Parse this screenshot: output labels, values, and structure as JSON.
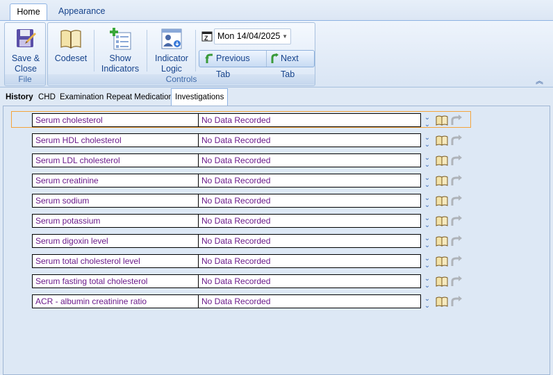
{
  "ribbon": {
    "tabs": [
      {
        "label": "Home",
        "active": true
      },
      {
        "label": "Appearance",
        "active": false
      }
    ],
    "groups": {
      "file": {
        "label": "File",
        "save_close_label_1": "Save &",
        "save_close_label_2": "Close"
      },
      "controls": {
        "label": "Controls",
        "codeset_label": "Codeset",
        "show_indicators_label_1": "Show",
        "show_indicators_label_2": "Indicators",
        "indicator_logic_label_1": "Indicator",
        "indicator_logic_label_2": "Logic",
        "date_value": "Mon 14/04/2025",
        "previous_tab_label": "Previous Tab",
        "next_tab_label": "Next Tab"
      }
    },
    "collapse_glyph": "«"
  },
  "content_tabs": [
    {
      "label": "History",
      "active": false
    },
    {
      "label": "CHD",
      "active": false
    },
    {
      "label": "Examination",
      "active": false
    },
    {
      "label": "Repeat Medication",
      "active": false
    },
    {
      "label": "Investigations",
      "active": true
    }
  ],
  "investigations": {
    "rows": [
      {
        "name": "Serum cholesterol",
        "value": "No Data Recorded"
      },
      {
        "name": "Serum HDL cholesterol",
        "value": "No Data Recorded"
      },
      {
        "name": "Serum LDL cholesterol",
        "value": "No Data Recorded"
      },
      {
        "name": "Serum creatinine",
        "value": "No Data Recorded"
      },
      {
        "name": "Serum sodium",
        "value": "No Data Recorded"
      },
      {
        "name": "Serum potassium",
        "value": "No Data Recorded"
      },
      {
        "name": "Serum digoxin level",
        "value": "No Data Recorded"
      },
      {
        "name": "Serum total cholesterol level",
        "value": "No Data Recorded"
      },
      {
        "name": "Serum fasting total cholesterol",
        "value": "No Data Recorded"
      },
      {
        "name": "ACR - albumin creatinine ratio",
        "value": "No Data Recorded"
      }
    ],
    "selected_row": 0
  },
  "colors": {
    "row_text": "#6b1a8a",
    "selection_border": "#f4a43b",
    "ribbon_text": "#15428b"
  }
}
